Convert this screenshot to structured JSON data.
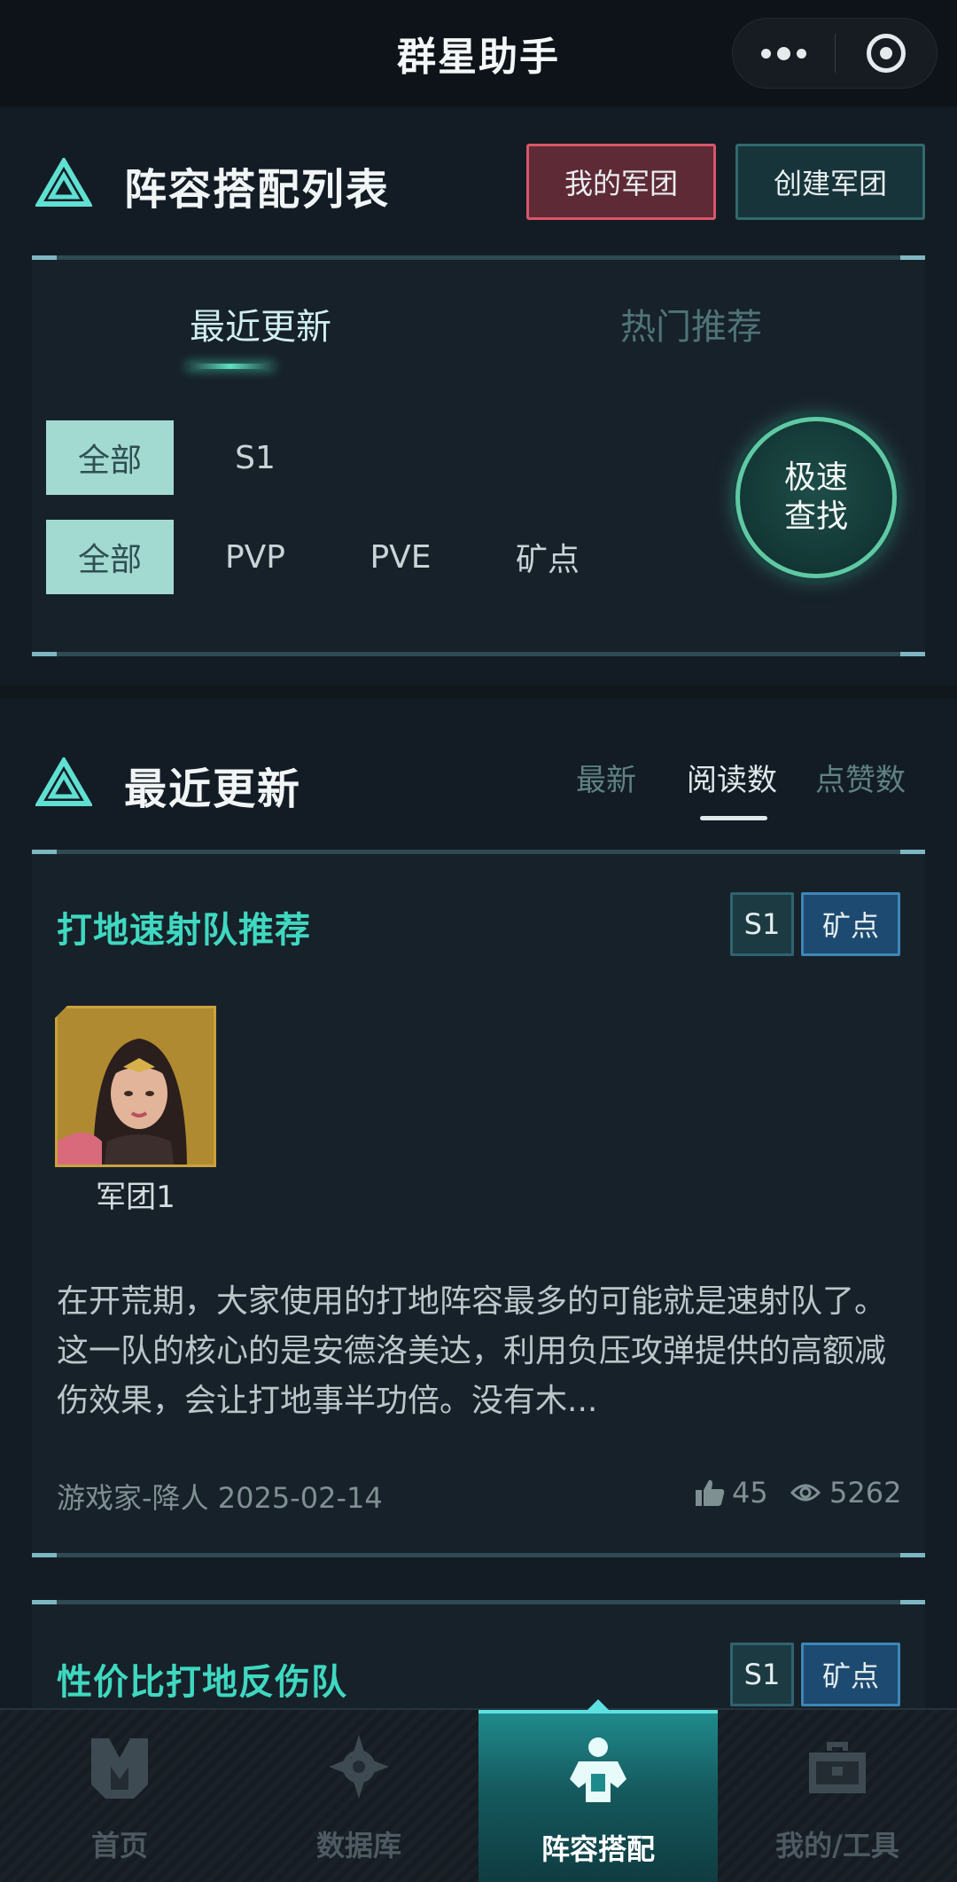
{
  "header": {
    "title": "群星助手"
  },
  "lineup_section": {
    "title": "阵容搭配列表",
    "my_legion_button": "我的军团",
    "create_legion_button": "创建军团",
    "tabs": [
      "最近更新",
      "热门推荐"
    ],
    "active_tab": "最近更新",
    "season_filters": [
      "全部",
      "S1"
    ],
    "mode_filters": [
      "全部",
      "PVP",
      "PVE",
      "矿点"
    ],
    "fast_search_label": "极速查找"
  },
  "recent_section": {
    "title": "最近更新",
    "sort_options": [
      "最新",
      "阅读数",
      "点赞数"
    ],
    "active_sort": "阅读数"
  },
  "cards": [
    {
      "title": "打地速射队推荐",
      "tags": [
        "S1",
        "矿点"
      ],
      "avatar_label": "军团1",
      "description": "在开荒期，大家使用的打地阵容最多的可能就是速射队了。这一队的核心的是安德洛美达，利用负压攻弹提供的高额减伤效果，会让打地事半功倍。没有木...",
      "author": "游戏家-降人",
      "date": "2025-02-14",
      "likes": "45",
      "views": "5262"
    },
    {
      "title": "性价比打地反伤队",
      "tags": [
        "S1",
        "矿点"
      ]
    }
  ],
  "nav": {
    "items": [
      {
        "label": "首页",
        "icon": "home-icon"
      },
      {
        "label": "数据库",
        "icon": "database-icon"
      },
      {
        "label": "阵容搭配",
        "icon": "lineup-icon"
      },
      {
        "label": "我的/工具",
        "icon": "toolbox-icon"
      }
    ],
    "active": "阵容搭配"
  },
  "colors": {
    "accent": "#3fd8c0",
    "red_button": "#d9566a",
    "ore_tag": "#3d86b8"
  }
}
